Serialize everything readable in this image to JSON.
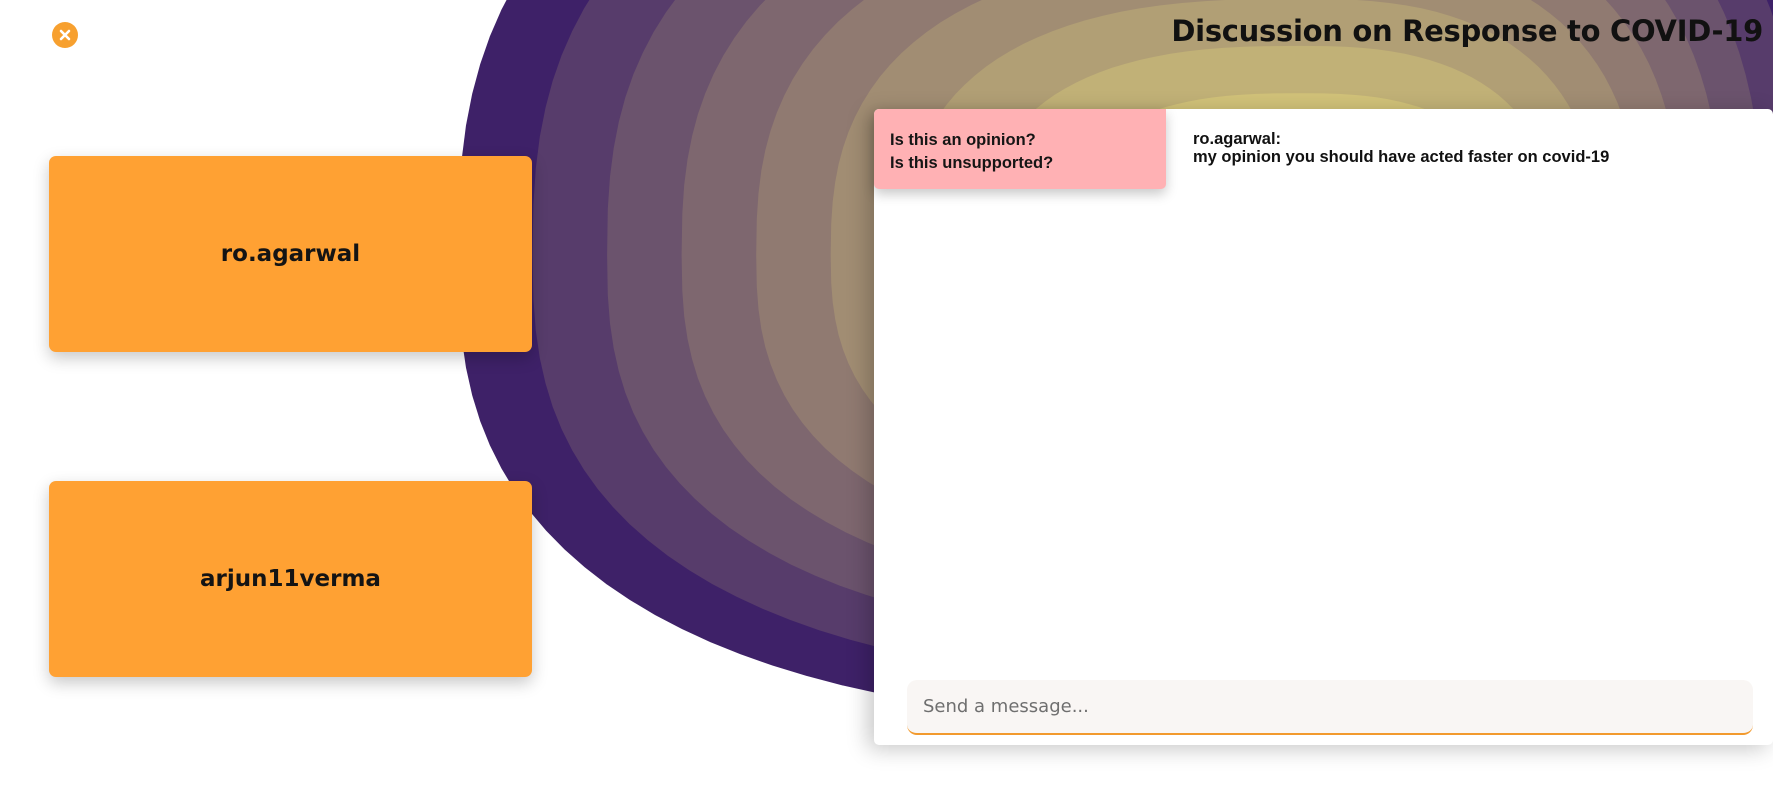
{
  "header": {
    "title": "Discussion on Response to COVID-19"
  },
  "icons": {
    "close": "close-icon"
  },
  "colors": {
    "accent_orange": "#ffa133",
    "flag_pink": "#ffb1b4",
    "title_yellow": "#fff47e",
    "blob_purple": "#3e2168"
  },
  "participants": [
    {
      "name": "ro.agarwal"
    },
    {
      "name": "arjun11verma"
    }
  ],
  "chat": {
    "flag": {
      "line1": "Is this an opinion?",
      "line2": "Is this unsupported?"
    },
    "messages": [
      {
        "author": "ro.agarwal:",
        "text": "my opinion you should have acted faster on covid-19"
      }
    ],
    "input": {
      "value": "",
      "placeholder": "Send a message..."
    }
  }
}
